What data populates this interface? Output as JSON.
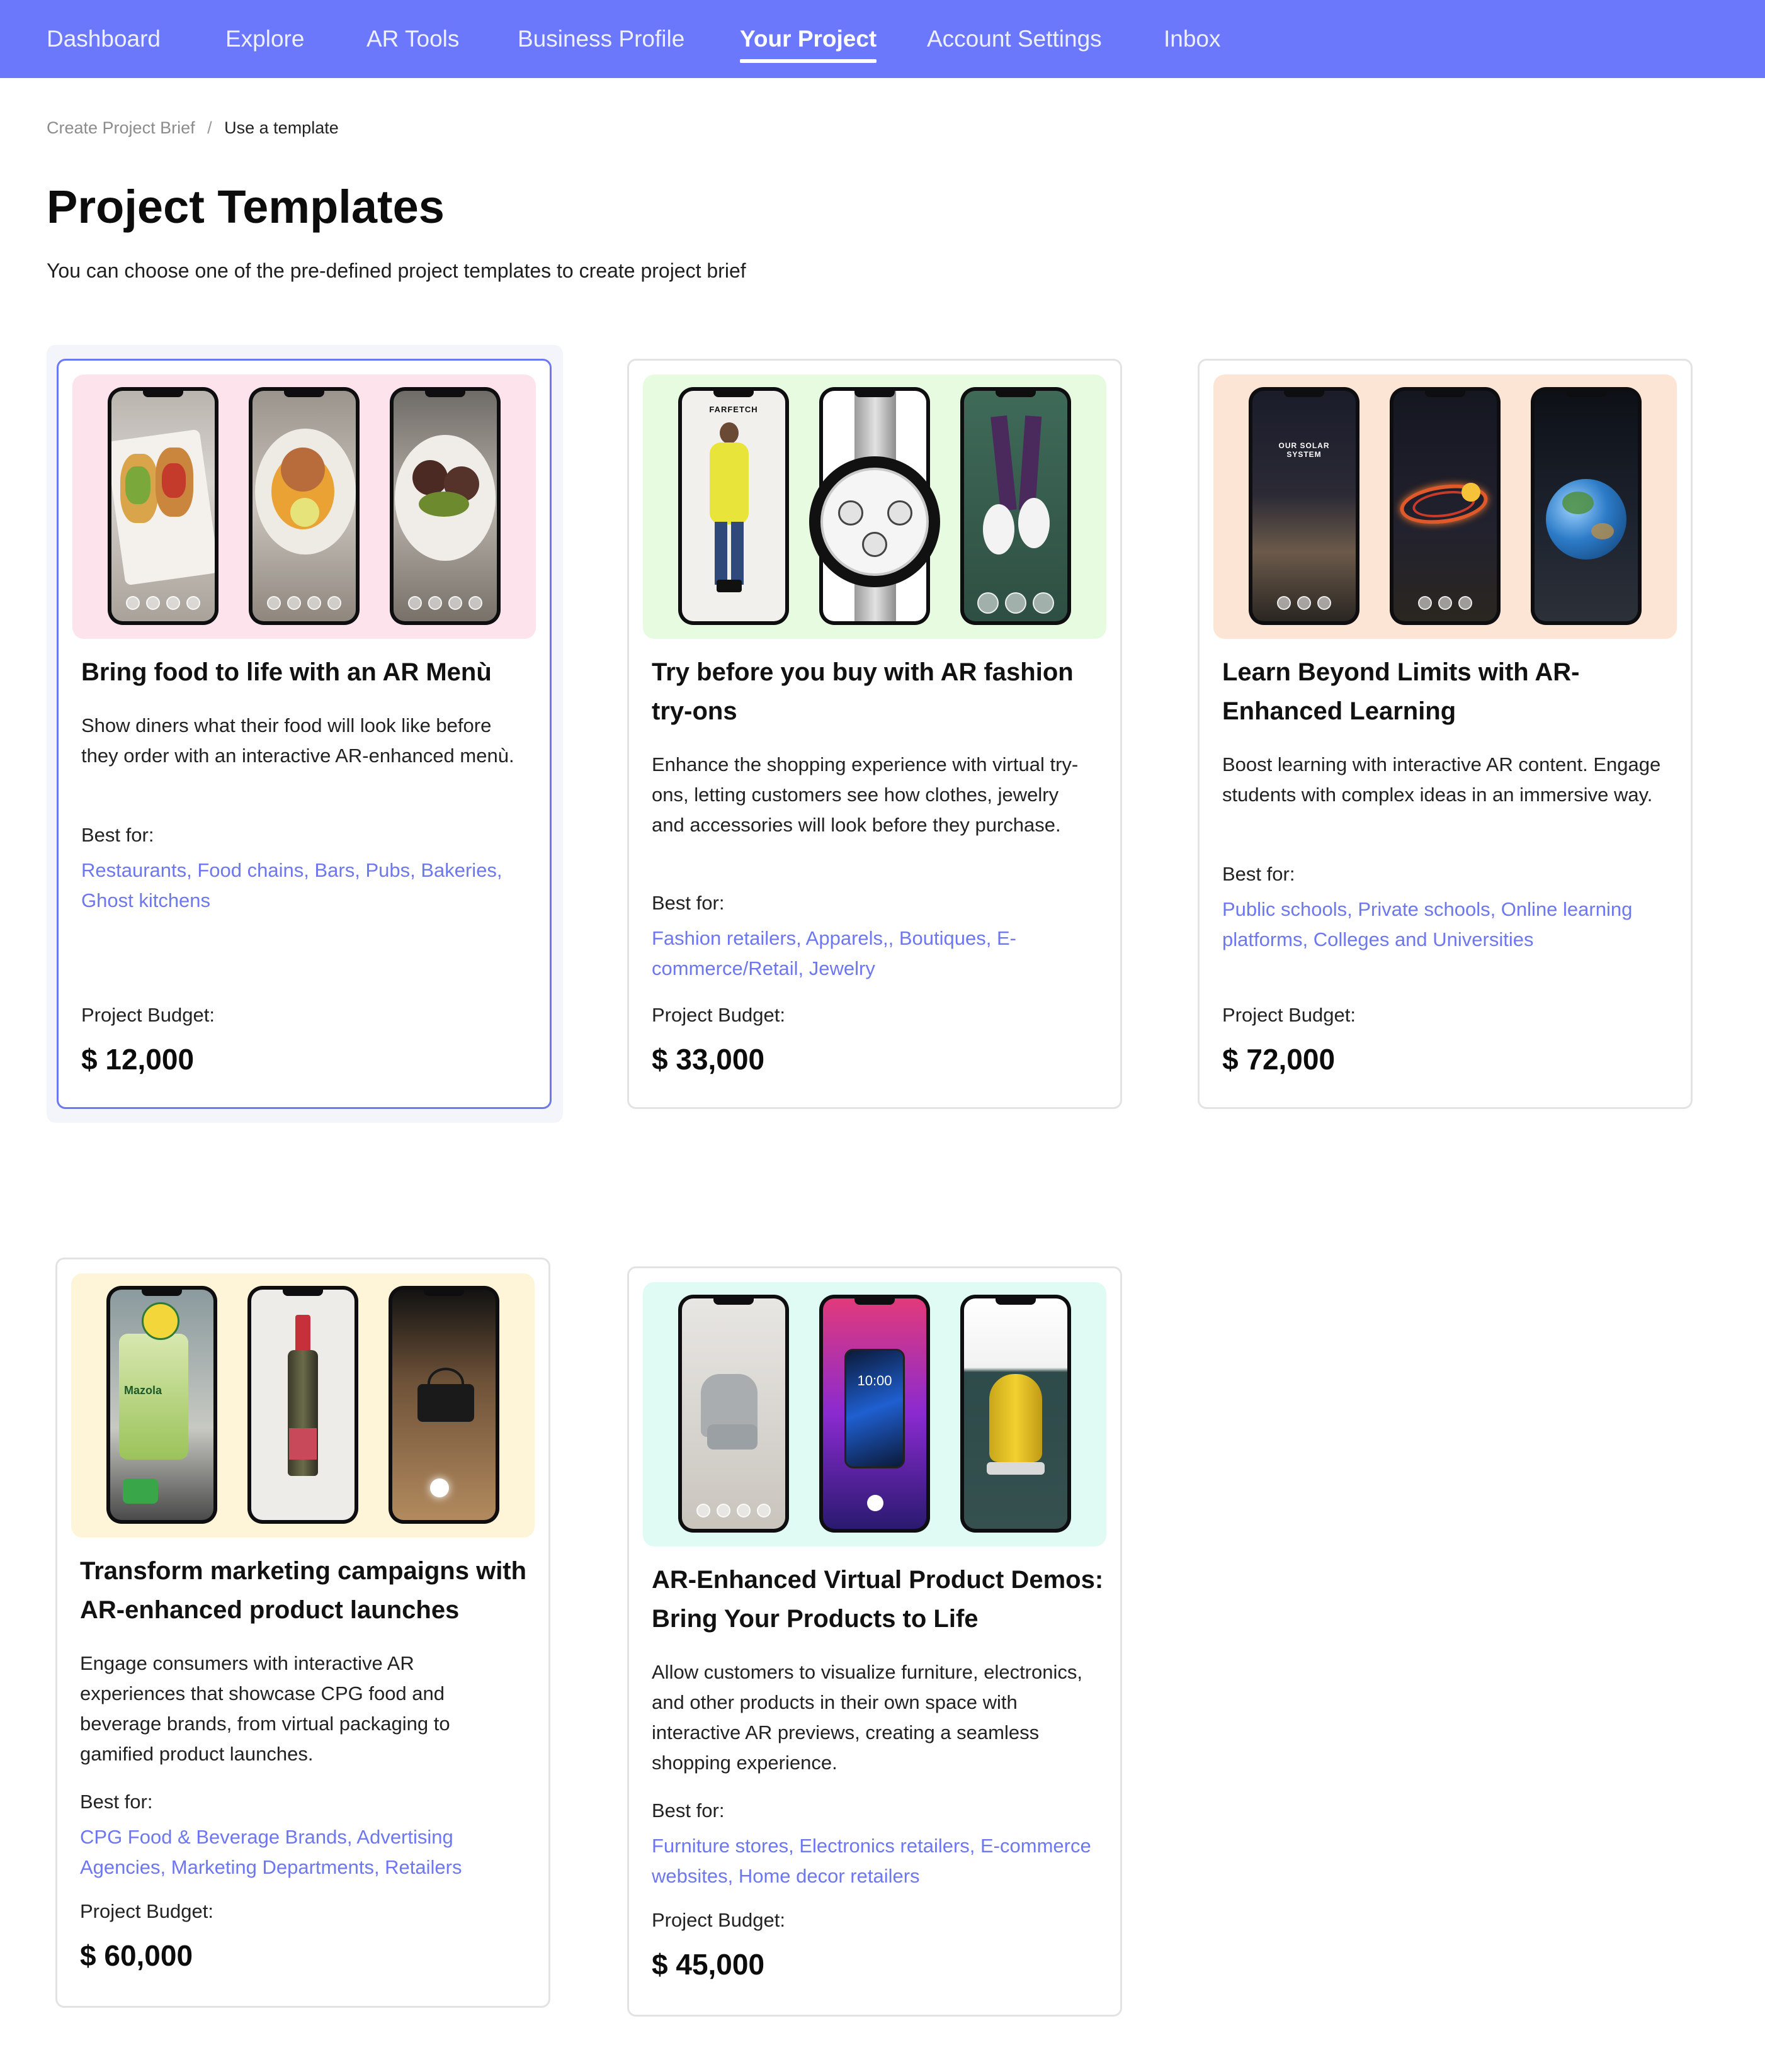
{
  "nav": {
    "items": [
      {
        "label": "Dashboard"
      },
      {
        "label": "Explore"
      },
      {
        "label": "AR Tools"
      },
      {
        "label": "Business Profile"
      },
      {
        "label": "Your Project"
      },
      {
        "label": "Account Settings"
      },
      {
        "label": "Inbox"
      }
    ],
    "active": "Your Project"
  },
  "breadcrumb": {
    "parent": "Create Project Brief",
    "separator": "/",
    "current": "Use a template"
  },
  "header": {
    "title": "Project Templates",
    "subtitle": "You can choose one of the pre-defined project templates to create project brief"
  },
  "templates": [
    {
      "title": "Bring food to life with an AR Menù",
      "description": "Show diners what their food will look like before they order with an interactive AR-enhanced menù.",
      "best_for_label": "Best for:",
      "best_for": "Restaurants, Food chains, Bars, Pubs, Bakeries, Ghost kitchens",
      "budget_label": "Project Budget:",
      "budget": "$ 12,000",
      "selected": true,
      "hero_color": "#fde3ec"
    },
    {
      "title": "Try before you buy with AR fashion try-ons",
      "description": "Enhance the shopping experience with virtual try-ons, letting customers see how clothes, jewelry and accessories will look before they purchase.",
      "best_for_label": "Best for:",
      "best_for": "Fashion retailers, Apparels,, Boutiques, E-commerce/Retail, Jewelry",
      "budget_label": "Project Budget:",
      "budget": "$ 33,000",
      "hero_color": "#e6fbe0",
      "screen_brand": "FARFETCH"
    },
    {
      "title": "Learn Beyond Limits with AR-Enhanced Learning",
      "description": "Boost learning with interactive AR content. Engage students with complex ideas in an immersive way.",
      "best_for_label": "Best for:",
      "best_for": "Public schools, Private schools, Online learning platforms, Colleges and Universities",
      "budget_label": "Project Budget:",
      "budget": "$ 72,000",
      "hero_color": "#fde5d6",
      "screen_text": "OUR SOLAR SYSTEM"
    },
    {
      "title": "Transform marketing campaigns with AR-enhanced product launches",
      "description": "Engage consumers with interactive AR experiences that showcase CPG food and beverage brands, from virtual packaging to gamified product launches.",
      "best_for_label": "Best for:",
      "best_for": "CPG Food & Beverage Brands, Advertising Agencies, Marketing Departments, Retailers",
      "budget_label": "Project Budget:",
      "budget": "$ 60,000",
      "hero_color": "#fef4d8",
      "screen_brand": "Mazola"
    },
    {
      "title": "AR-Enhanced Virtual Product Demos: Bring Your Products to Life",
      "description": "Allow customers to visualize furniture, electronics, and other products in their own space with interactive AR previews, creating a seamless shopping experience.",
      "best_for_label": "Best for:",
      "best_for": "Furniture stores, Electronics retailers, E-commerce websites, Home decor retailers",
      "budget_label": "Project Budget:",
      "budget": "$ 45,000",
      "hero_color": "#e0fbf3",
      "screen_time": "10:00"
    }
  ],
  "colors": {
    "nav_bg": "#6b78fc",
    "accent": "#6d77f0",
    "selected_border": "#6d77f0"
  }
}
